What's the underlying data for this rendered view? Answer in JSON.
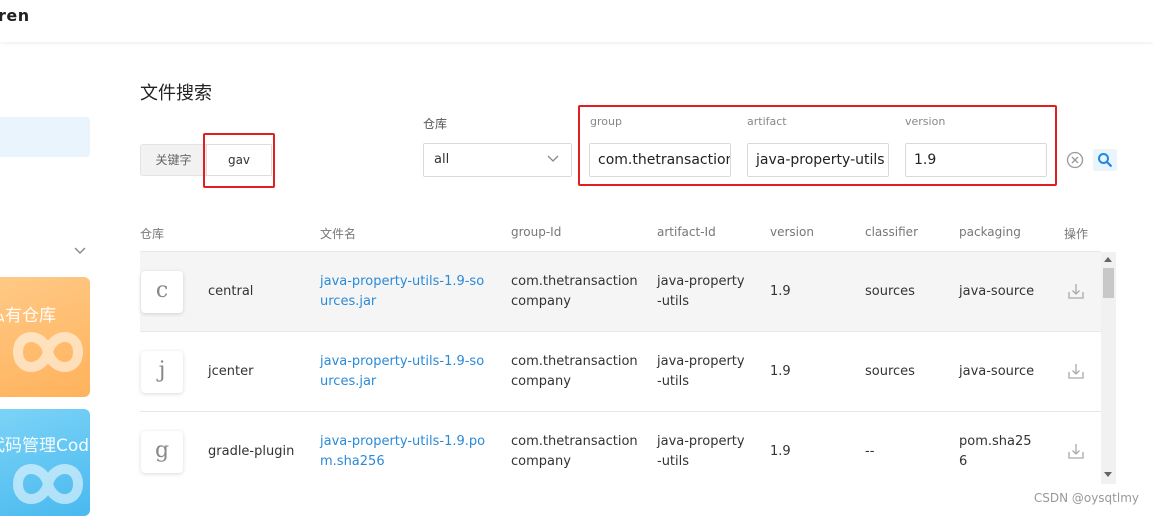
{
  "header": {
    "logo_text": "ren"
  },
  "sidebar": {
    "promo_1": "私有仓库",
    "promo_2": "代码管理Codeup"
  },
  "page": {
    "title": "文件搜索"
  },
  "search": {
    "keyword_label": "关键字",
    "keyword_value": "gav",
    "repo_label": "仓库",
    "repo_selected": "all",
    "group_label": "group",
    "group_value": "com.thetransaction",
    "artifact_label": "artifact",
    "artifact_value": "java-property-utils",
    "version_label": "version",
    "version_value": "1.9"
  },
  "table": {
    "headers": [
      "仓库",
      "文件名",
      "group-Id",
      "artifact-Id",
      "version",
      "classifier",
      "packaging",
      "操作"
    ],
    "rows": [
      {
        "avatar": "c",
        "repo": "central",
        "filename_1": "java-property-utils-1.9-so",
        "filename_2": "urces.jar",
        "group_1": "com.thetransaction",
        "group_2": "company",
        "artifact_1": "java-property",
        "artifact_2": "-utils",
        "version": "1.9",
        "classifier": "sources",
        "packaging_1": "java-source",
        "packaging_2": ""
      },
      {
        "avatar": "j",
        "repo": "jcenter",
        "filename_1": "java-property-utils-1.9-so",
        "filename_2": "urces.jar",
        "group_1": "com.thetransaction",
        "group_2": "company",
        "artifact_1": "java-property",
        "artifact_2": "-utils",
        "version": "1.9",
        "classifier": "sources",
        "packaging_1": "java-source",
        "packaging_2": ""
      },
      {
        "avatar": "g",
        "repo": "gradle-plugin",
        "filename_1": "java-property-utils-1.9.po",
        "filename_2": "m.sha256",
        "group_1": "com.thetransaction",
        "group_2": "company",
        "artifact_1": "java-property",
        "artifact_2": "-utils",
        "version": "1.9",
        "classifier": "--",
        "packaging_1": "pom.sha25",
        "packaging_2": "6"
      }
    ]
  },
  "watermark": "CSDN @oysqtlmy",
  "colors": {
    "link": "#2b8ad8",
    "highlight_red": "#e02020",
    "accent_blue": "#1e88e5"
  }
}
